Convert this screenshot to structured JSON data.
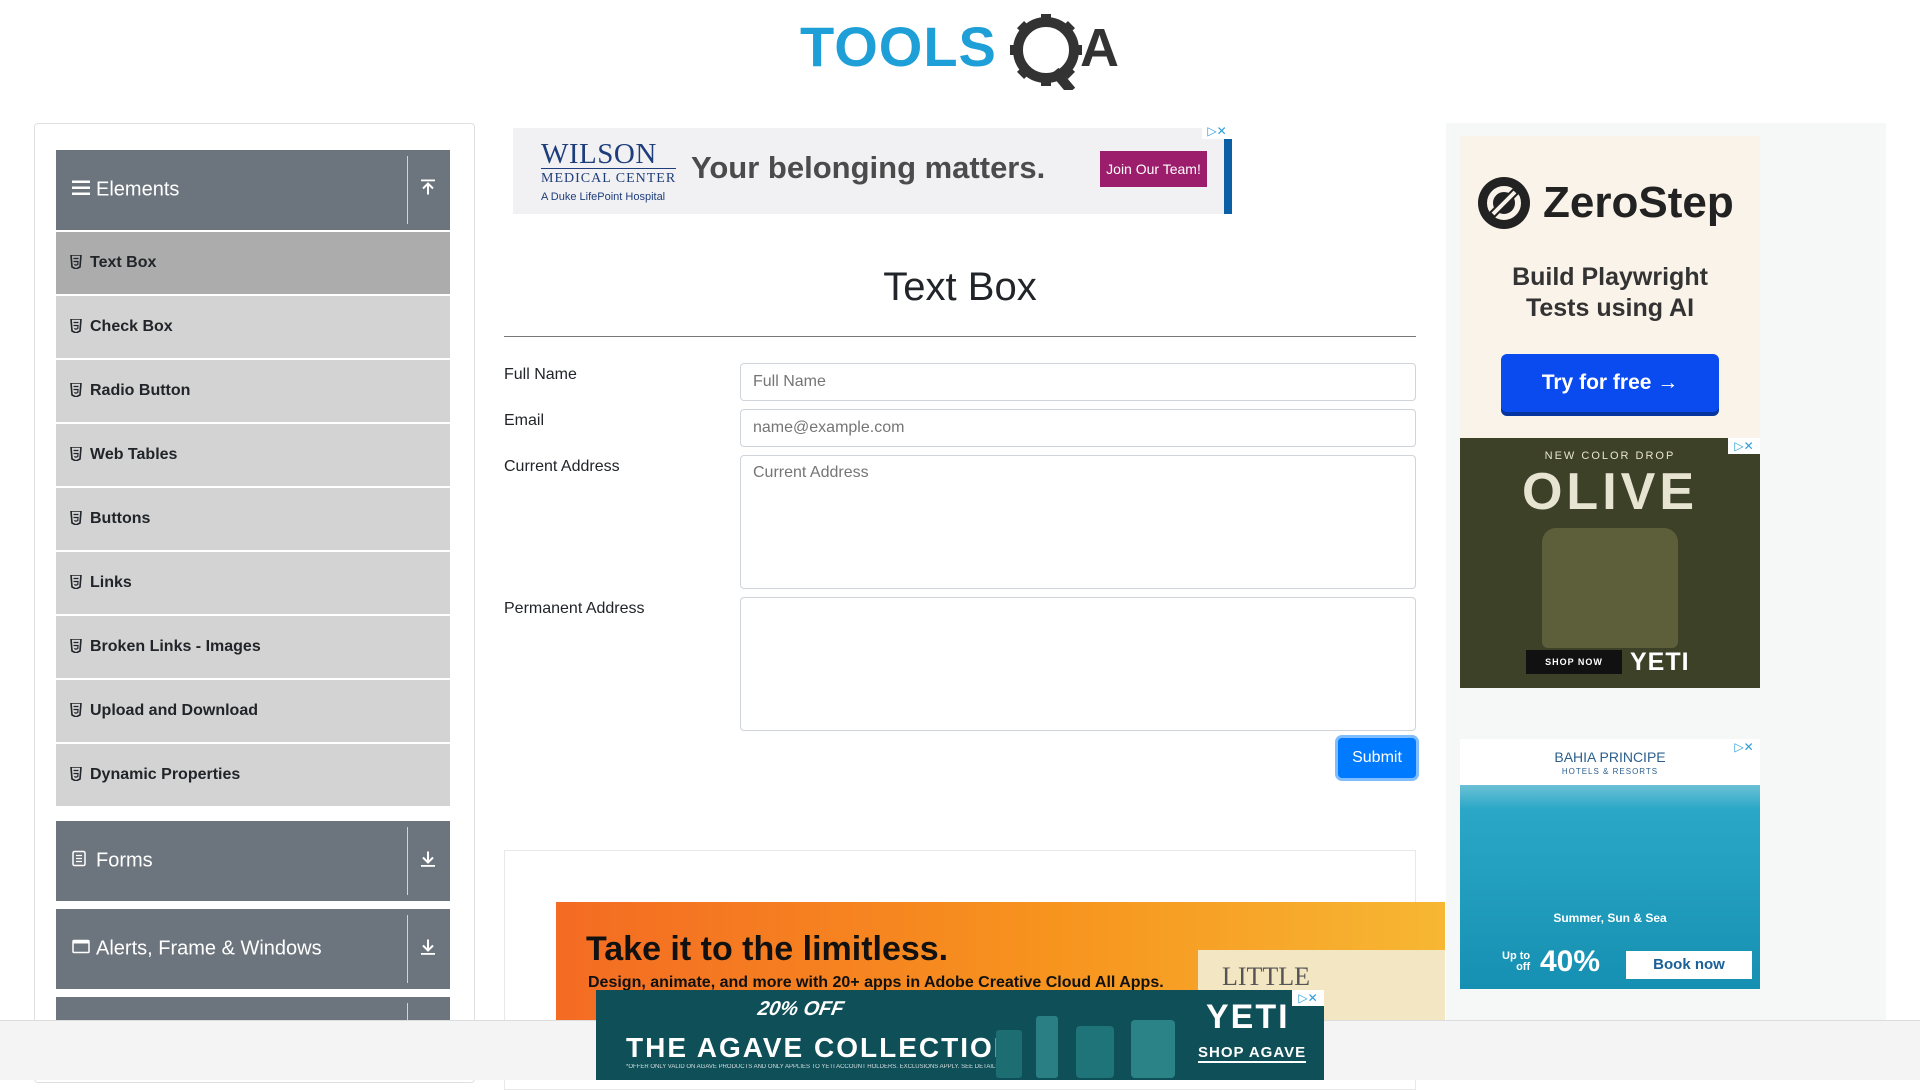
{
  "header": {
    "logo_text": "TOOLSQA",
    "logo_part1": "TOOLS",
    "logo_part2": "A"
  },
  "sidebar": {
    "groups": [
      {
        "title": "Elements",
        "expanded": true,
        "items": [
          {
            "label": "Text Box",
            "active": true
          },
          {
            "label": "Check Box"
          },
          {
            "label": "Radio Button"
          },
          {
            "label": "Web Tables"
          },
          {
            "label": "Buttons"
          },
          {
            "label": "Links"
          },
          {
            "label": "Broken Links - Images"
          },
          {
            "label": "Upload and Download"
          },
          {
            "label": "Dynamic Properties"
          }
        ]
      },
      {
        "title": "Forms",
        "expanded": false
      },
      {
        "title": "Alerts, Frame & Windows",
        "expanded": false
      }
    ]
  },
  "ads": {
    "top": {
      "brand_line1": "WILSON",
      "brand_line2": "MEDICAL CENTER",
      "brand_line3": "A Duke LifePoint Hospital",
      "slogan": "Your belonging matters.",
      "cta": "Join Our Team!"
    },
    "zerostep": {
      "name": "ZeroStep",
      "tagline_1": "Build Playwright",
      "tagline_2": "Tests using AI",
      "cta": "Try for free →"
    },
    "yeti_right": {
      "kicker": "NEW COLOR DROP",
      "headline": "OLIVE",
      "cta": "SHOP NOW",
      "brand": "YETI"
    },
    "bahia": {
      "brand": "BAHIA PRINCIPE",
      "sub": "HOTELS & RESORTS",
      "slogan": "Summer, Sun & Sea",
      "upto_1": "Up to",
      "upto_2": "off",
      "discount": "40%",
      "cta": "Book now"
    },
    "adobe": {
      "headline": "Take it to the limitless.",
      "sub": "Design, animate, and more with 20+ apps in Adobe Creative Cloud All Apps.",
      "book_text": "LITTLE"
    },
    "agave": {
      "offer": "20% OFF",
      "title": "THE AGAVE COLLECTION",
      "fine": "*OFFER ONLY VALID ON AGAVE PRODUCTS AND ONLY APPLIES TO YETI ACCOUNT HOLDERS. EXCLUSIONS APPLY. SEE DETAILS.",
      "brand": "YETI",
      "cta": "SHOP AGAVE"
    }
  },
  "main": {
    "title": "Text Box",
    "form": {
      "full_name_label": "Full Name",
      "full_name_placeholder": "Full Name",
      "email_label": "Email",
      "email_placeholder": "name@example.com",
      "current_address_label": "Current Address",
      "current_address_placeholder": "Current Address",
      "permanent_address_label": "Permanent Address",
      "permanent_address_placeholder": "",
      "submit_label": "Submit"
    }
  },
  "colors": {
    "sidebar_header": "#6c757d",
    "menu_item": "#d3d3d3",
    "menu_item_active": "#acacac",
    "primary": "#007bff",
    "logo_blue": "#1e9fd8",
    "logo_dark": "#333333"
  }
}
